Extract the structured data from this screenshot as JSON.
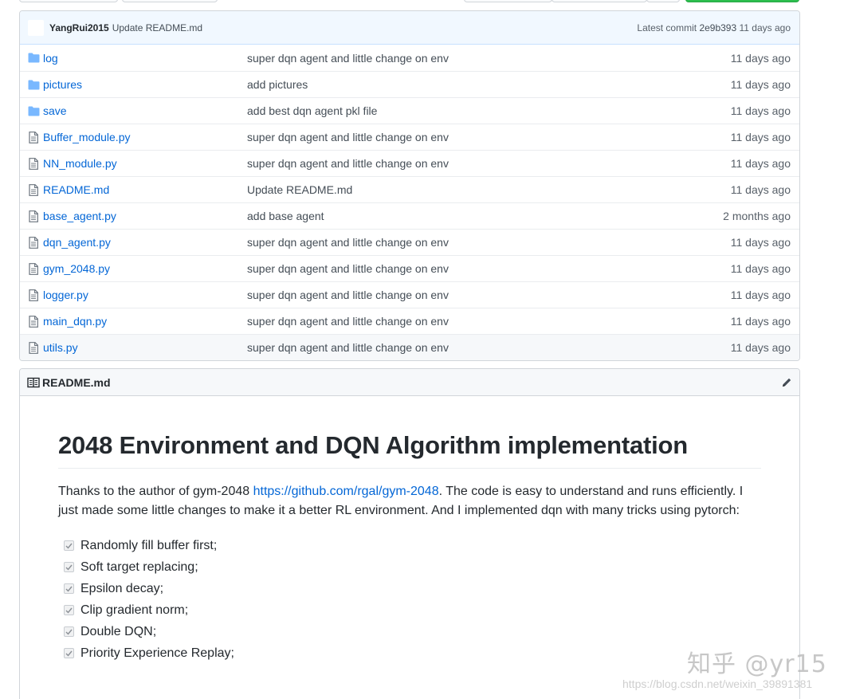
{
  "commit": {
    "author": "YangRui2015",
    "message": "Update README.md",
    "latest_label": "Latest commit",
    "sha": "2e9b393",
    "age": "11 days ago"
  },
  "files": [
    {
      "type": "folder",
      "name": "log",
      "message": "super dqn agent and little change on env",
      "age": "11 days ago"
    },
    {
      "type": "folder",
      "name": "pictures",
      "message": "add pictures",
      "age": "11 days ago"
    },
    {
      "type": "folder",
      "name": "save",
      "message": "add best dqn agent pkl file",
      "age": "11 days ago"
    },
    {
      "type": "file",
      "name": "Buffer_module.py",
      "message": "super dqn agent and little change on env",
      "age": "11 days ago"
    },
    {
      "type": "file",
      "name": "NN_module.py",
      "message": "super dqn agent and little change on env",
      "age": "11 days ago"
    },
    {
      "type": "file",
      "name": "README.md",
      "message": "Update README.md",
      "age": "11 days ago"
    },
    {
      "type": "file",
      "name": "base_agent.py",
      "message": "add base agent",
      "age": "2 months ago"
    },
    {
      "type": "file",
      "name": "dqn_agent.py",
      "message": "super dqn agent and little change on env",
      "age": "11 days ago"
    },
    {
      "type": "file",
      "name": "gym_2048.py",
      "message": "super dqn agent and little change on env",
      "age": "11 days ago"
    },
    {
      "type": "file",
      "name": "logger.py",
      "message": "super dqn agent and little change on env",
      "age": "11 days ago"
    },
    {
      "type": "file",
      "name": "main_dqn.py",
      "message": "super dqn agent and little change on env",
      "age": "11 days ago"
    },
    {
      "type": "file",
      "name": "utils.py",
      "message": "super dqn agent and little change on env",
      "age": "11 days ago"
    }
  ],
  "readme": {
    "header": "README.md",
    "title": "2048 Environment and DQN Algorithm implementation",
    "para_before": "Thanks to the author of gym-2048 ",
    "link": "https://github.com/rgal/gym-2048",
    "para_after": ". The code is easy to understand and runs efficiently. I just made some little changes to make it a better RL environment. And I implemented dqn with many tricks using pytorch:",
    "tasks": [
      "Randomly fill buffer first;",
      "Soft target replacing;",
      "Epsilon decay;",
      "Clip gradient norm;",
      "Double DQN;",
      "Priority Experience Replay;"
    ]
  },
  "watermark": {
    "logo": "知乎 @yr15",
    "url": "https://blog.csdn.net/weixin_39891381"
  },
  "colors": {
    "link": "#0366d6",
    "folder_icon": "#79b8ff",
    "file_icon": "#6a737d",
    "commit_bar": "#f1f8ff"
  }
}
